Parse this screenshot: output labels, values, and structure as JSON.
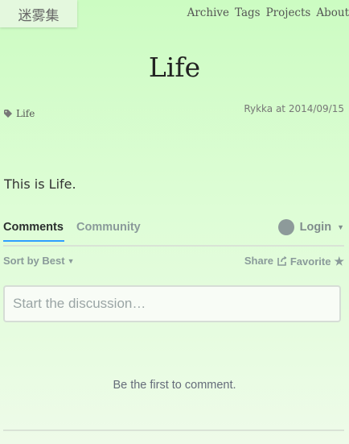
{
  "site": {
    "logo": "迷雾集"
  },
  "nav": [
    {
      "label": "Archive"
    },
    {
      "label": "Tags"
    },
    {
      "label": "Projects"
    },
    {
      "label": "About"
    }
  ],
  "post": {
    "title": "Life",
    "tag": "Life",
    "meta": "Rykka at 2014/09/15",
    "body": "This is Life."
  },
  "comments": {
    "tabs": [
      {
        "label": "Comments",
        "active": true
      },
      {
        "label": "Community",
        "active": false
      }
    ],
    "login_label": "Login",
    "sort_label": "Sort by Best",
    "share_label": "Share",
    "favorite_label": "Favorite",
    "composer_placeholder": "Start the discussion…",
    "empty_text": "Be the first to comment."
  },
  "icons": {
    "tag": "tag-icon",
    "avatar": "avatar",
    "share": "share-icon",
    "favorite": "star-icon"
  },
  "colors": {
    "accent": "#2e9fff",
    "background": "#ccfcc2"
  }
}
